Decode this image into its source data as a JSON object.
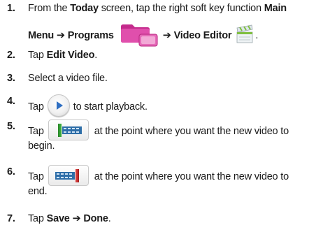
{
  "steps": [
    {
      "number": "1.",
      "t1": "From the ",
      "b1": "Today",
      "t2": " screen, tap the right soft key function ",
      "b2": "Main",
      "b3": "Menu",
      "arrow1": "➔",
      "b4": "Programs",
      "arrow2": "➔",
      "b5": "Video Editor",
      "t3": "."
    },
    {
      "number": "2.",
      "t1": "Tap ",
      "b1": "Edit Video",
      "t2": "."
    },
    {
      "number": "3.",
      "t1": "Select a video file."
    },
    {
      "number": "4.",
      "t1": "Tap",
      "t2": "to start playback."
    },
    {
      "number": "5.",
      "t1": "Tap",
      "t2": "at the point where you want the new video to",
      "t3": "begin."
    },
    {
      "number": "6.",
      "t1": "Tap",
      "t2": "at the point where you want the new video to",
      "t3": "end."
    },
    {
      "number": "7.",
      "t1": "Tap ",
      "b1": "Save",
      "arrow": "➔",
      "b2": "Done",
      "t2": "."
    }
  ],
  "icons": {
    "programs": "programs-folder-icon",
    "video_editor": "video-editor-icon",
    "play": "play-icon",
    "mark_begin": "mark-begin-icon",
    "mark_end": "mark-end-icon"
  },
  "colors": {
    "text": "#1a1a1a",
    "folder": "#d93fa2",
    "play": "#2f6fc2",
    "begin_marker": "#3aa83a",
    "end_marker": "#d23a3a",
    "film": "#2e6ea8"
  }
}
